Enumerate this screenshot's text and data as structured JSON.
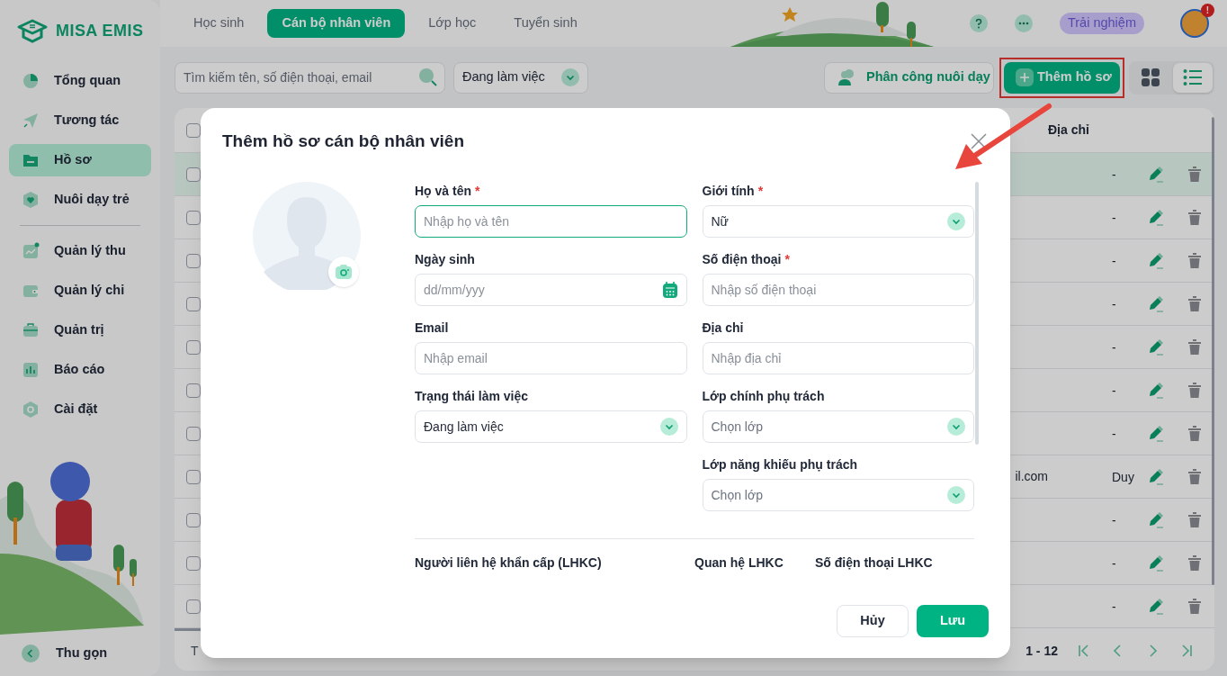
{
  "app": {
    "logo": "MISA EMIS"
  },
  "sidebar": {
    "groups": [
      [
        {
          "label": "Tổng quan",
          "selected": false
        },
        {
          "label": "Tương tác",
          "selected": false
        },
        {
          "label": "Hồ sơ",
          "selected": true
        },
        {
          "label": "Nuôi dạy trẻ",
          "selected": false
        }
      ],
      [
        {
          "label": "Quản lý thu",
          "selected": false
        },
        {
          "label": "Quản lý chi",
          "selected": false
        },
        {
          "label": "Quản trị",
          "selected": false
        },
        {
          "label": "Báo cáo",
          "selected": false
        },
        {
          "label": "Cài đặt",
          "selected": false
        }
      ]
    ],
    "collapse": "Thu gọn"
  },
  "top_tabs": [
    {
      "label": "Học sinh",
      "selected": false
    },
    {
      "label": "Cán bộ nhân viên",
      "selected": true
    },
    {
      "label": "Lớp học",
      "selected": false
    },
    {
      "label": "Tuyển sinh",
      "selected": false
    }
  ],
  "header": {
    "trial_badge": "Trải nghiệm",
    "notification_badge": "!"
  },
  "toolbar": {
    "search_placeholder": "Tìm kiếm tên, số điện thoại, email",
    "status_filter": "Đang làm việc",
    "assign_button": "Phân công nuôi dạy",
    "add_button": "Thêm hồ sơ",
    "views": [
      {
        "kind": "grid",
        "selected": false
      },
      {
        "kind": "list",
        "selected": true
      }
    ]
  },
  "table": {
    "columns": [
      "Địa chỉ"
    ],
    "header_checked": false,
    "rows": [
      {
        "selected": true,
        "checked": false,
        "address": "-"
      },
      {
        "selected": false,
        "checked": false,
        "address": "-"
      },
      {
        "selected": false,
        "checked": false,
        "address": "-"
      },
      {
        "selected": false,
        "checked": false,
        "address": "-"
      },
      {
        "selected": false,
        "checked": false,
        "address": "-"
      },
      {
        "selected": false,
        "checked": false,
        "address": "-"
      },
      {
        "selected": false,
        "checked": false,
        "address": "-"
      },
      {
        "selected": false,
        "checked": false,
        "email": "il.com",
        "address": "Duy"
      },
      {
        "selected": false,
        "checked": false,
        "address": "-"
      },
      {
        "selected": false,
        "checked": false,
        "address": "-"
      },
      {
        "selected": false,
        "checked": false,
        "address": "-"
      }
    ]
  },
  "pagination": {
    "total_label": "T",
    "range": "1 - 12"
  },
  "dialog": {
    "title": "Thêm hồ sơ cán bộ nhân viên",
    "columns": [
      {
        "fields": [
          {
            "label": "Họ và tên",
            "required_mark": "*",
            "kind": "text",
            "placeholder": "Nhập họ và tên",
            "focused": true
          },
          {
            "label": "Ngày sinh",
            "kind": "date",
            "placeholder": "dd/mm/yyy",
            "focused": false
          },
          {
            "label": "Email",
            "kind": "text",
            "placeholder": "Nhập email",
            "focused": false
          },
          {
            "label": "Trạng thái làm việc",
            "kind": "select",
            "value": "Đang làm việc",
            "focused": false
          }
        ]
      },
      {
        "fields": [
          {
            "label": "Giới tính",
            "required_mark": "*",
            "kind": "select",
            "value": "Nữ",
            "focused": false
          },
          {
            "label": "Số điện thoại",
            "required_mark": "*",
            "kind": "text",
            "placeholder": "Nhập số điện thoại",
            "focused": false
          },
          {
            "label": "Địa chỉ",
            "kind": "text",
            "placeholder": "Nhập địa chỉ",
            "focused": false
          },
          {
            "label": "Lớp chính phụ trách",
            "kind": "select",
            "placeholder": "Chọn lớp",
            "focused": false
          },
          {
            "label": "Lớp năng khiếu phụ trách",
            "kind": "select",
            "placeholder": "Chọn lớp",
            "focused": false
          }
        ]
      }
    ],
    "emergency_columns": [
      "Người liên hệ khẩn cấp (LHKC)",
      "Quan hệ LHKC",
      "Số điện thoại LHKC"
    ],
    "cancel_button": "Hủy",
    "save_button": "Lưu"
  }
}
